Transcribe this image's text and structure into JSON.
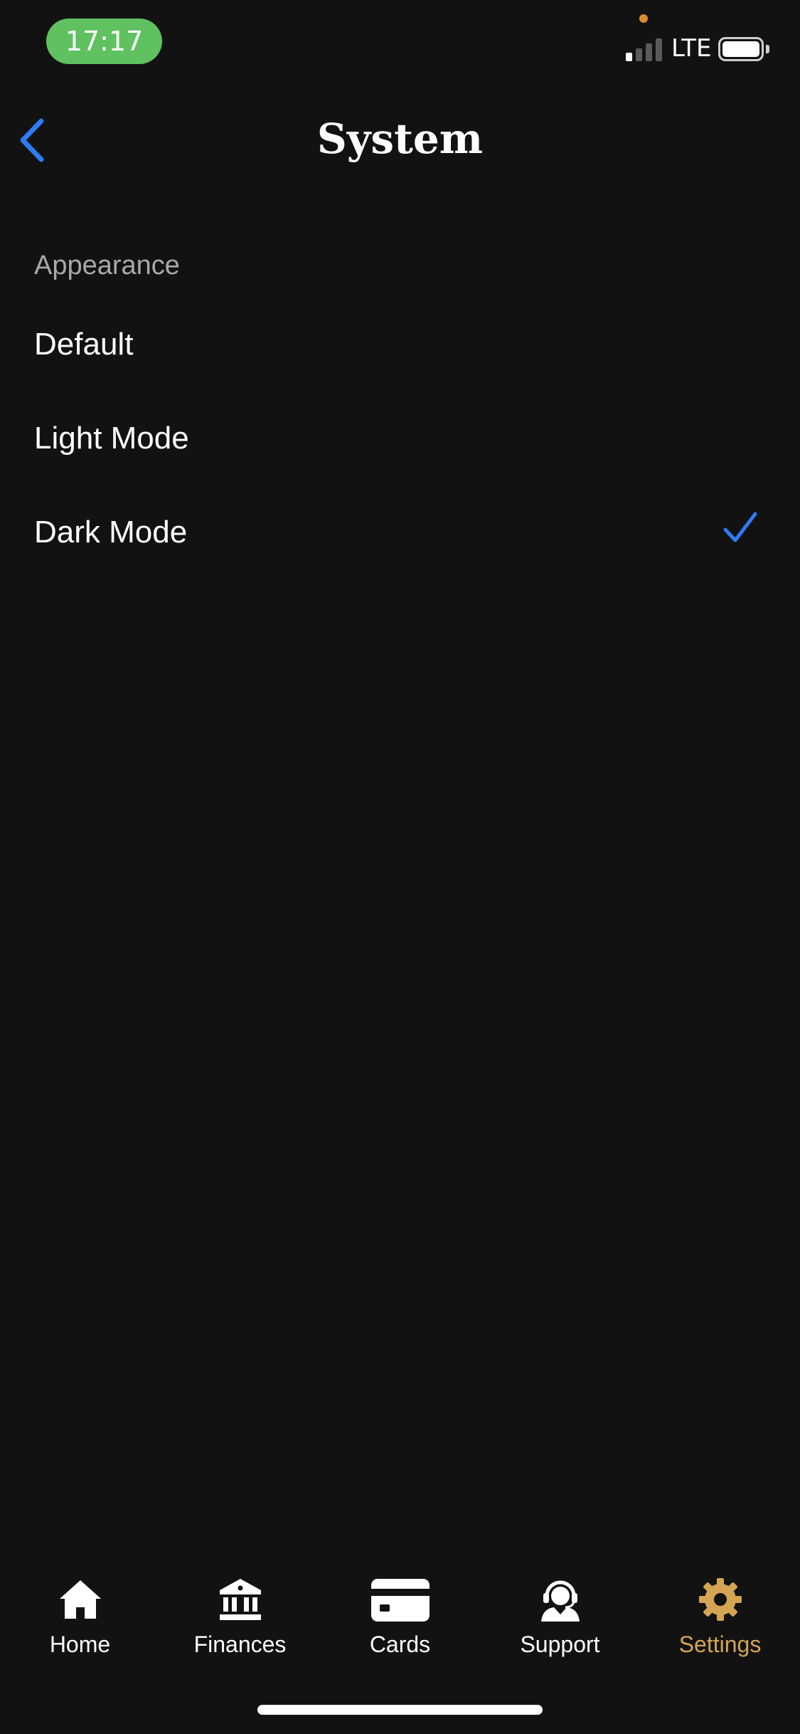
{
  "status_bar": {
    "time": "17:17",
    "network": "LTE",
    "signal_bars_on": 1,
    "signal_bars_total": 4,
    "time_pill_color": "#5fc160",
    "privacy_dot_color": "#e08a2c"
  },
  "header": {
    "title": "System",
    "back_icon": "chevron-left-icon",
    "accent_color": "#2f7bf5"
  },
  "appearance": {
    "section_label": "Appearance",
    "options": [
      {
        "label": "Default",
        "selected": false
      },
      {
        "label": "Light Mode",
        "selected": false
      },
      {
        "label": "Dark Mode",
        "selected": true
      }
    ],
    "selected_icon": "checkmark-icon"
  },
  "tab_bar": {
    "active_color": "#d4a553",
    "tabs": [
      {
        "label": "Home",
        "icon": "home-icon",
        "active": false
      },
      {
        "label": "Finances",
        "icon": "bank-icon",
        "active": false
      },
      {
        "label": "Cards",
        "icon": "credit-card-icon",
        "active": false
      },
      {
        "label": "Support",
        "icon": "support-agent-icon",
        "active": false
      },
      {
        "label": "Settings",
        "icon": "gear-icon",
        "active": true
      }
    ]
  }
}
